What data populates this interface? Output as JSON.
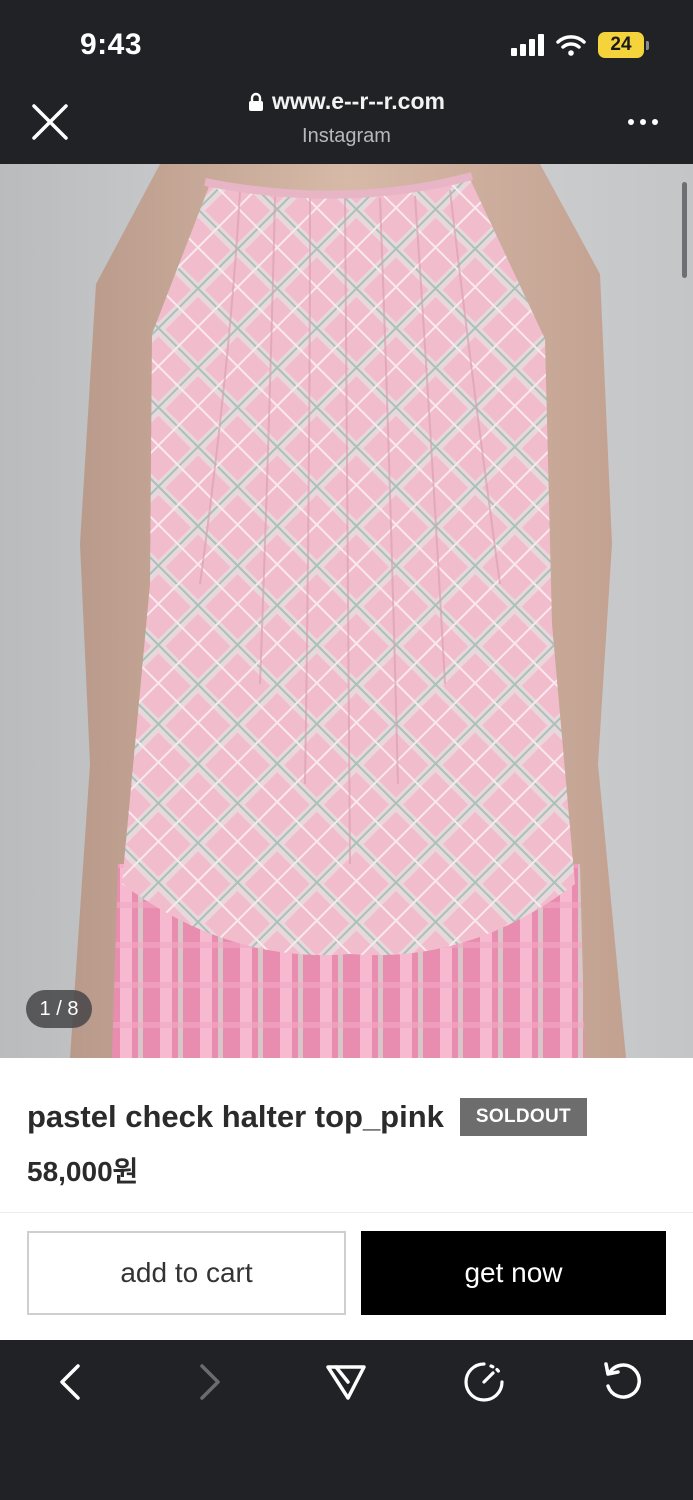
{
  "status_bar": {
    "time": "9:43",
    "battery": "24"
  },
  "browser": {
    "url": "www.e--r--r.com",
    "source": "Instagram"
  },
  "gallery": {
    "pager": "1 / 8"
  },
  "product": {
    "title": "pastel check halter top_pink",
    "status_badge": "SOLDOUT",
    "price": "58,000원"
  },
  "actions": {
    "add_to_cart": "add to cart",
    "get_now": "get now"
  },
  "toolbar": {
    "icons": [
      "back-icon",
      "forward-icon",
      "share-icon",
      "speed-icon",
      "refresh-icon"
    ]
  },
  "colors": {
    "chrome_bg": "#202226",
    "badge_bg": "#6d6d6d",
    "primary_button": "#000000",
    "battery": "#f4d43a"
  }
}
